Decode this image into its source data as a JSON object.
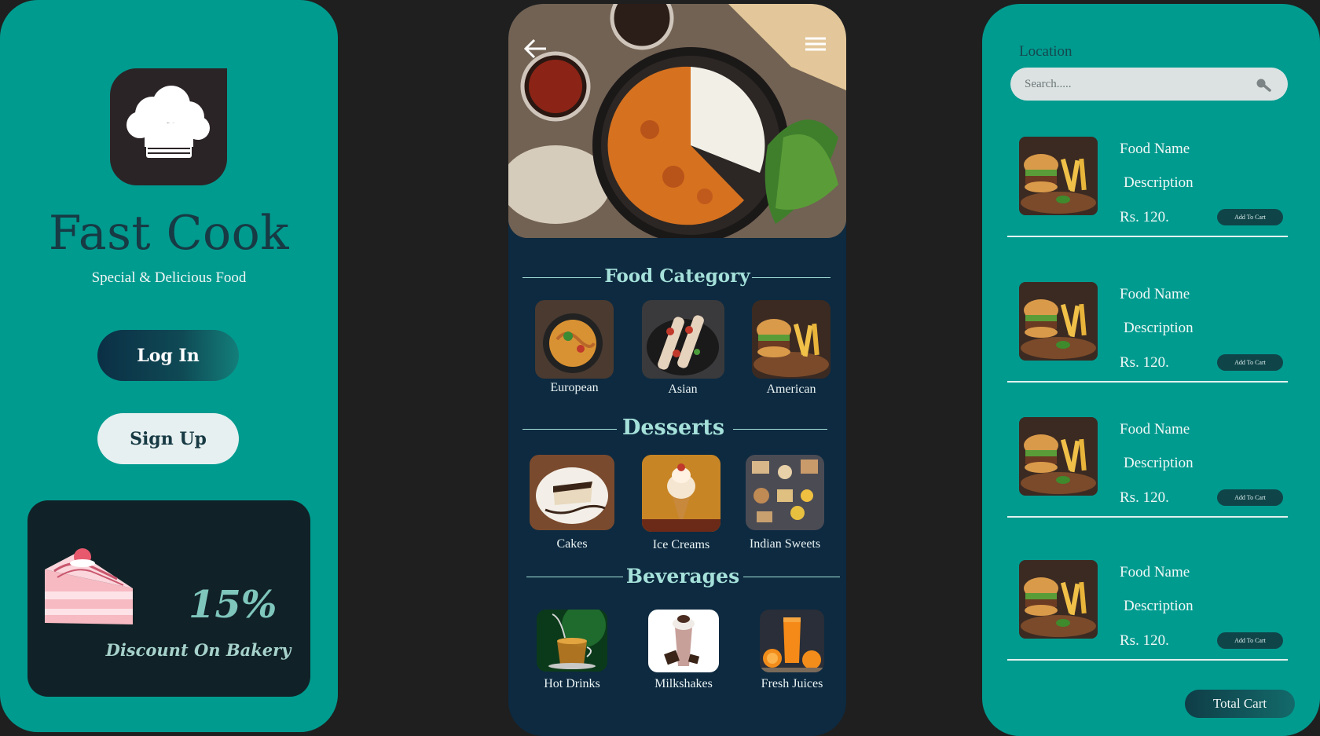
{
  "login_screen": {
    "brand_title": "Fast Cook",
    "brand_subtitle": "Special & Delicious Food",
    "login_label": "Log In",
    "signup_label": "Sign Up",
    "logo_icon": "chef-hat-icon",
    "promo": {
      "percent": "15%",
      "text": "Discount On Bakery",
      "image": "cake-slice"
    }
  },
  "category_screen": {
    "back_icon": "arrow-left-icon",
    "menu_icon": "hamburger-menu-icon",
    "hero_image": "curry-rice-bowl",
    "sections": [
      {
        "title": "Food Category",
        "items": [
          {
            "label": "European",
            "image": "pasta"
          },
          {
            "label": "Asian",
            "image": "skewers"
          },
          {
            "label": "American",
            "image": "burger-fries"
          }
        ]
      },
      {
        "title": "Desserts",
        "items": [
          {
            "label": "Cakes",
            "image": "cheesecake"
          },
          {
            "label": "Ice Creams",
            "image": "ice-cream-cone"
          },
          {
            "label": "Indian Sweets",
            "image": "indian-sweets"
          }
        ]
      },
      {
        "title": "Beverages",
        "items": [
          {
            "label": "Hot Drinks",
            "image": "tea-cup"
          },
          {
            "label": "Milkshakes",
            "image": "milkshake"
          },
          {
            "label": "Fresh Juices",
            "image": "orange-juice"
          }
        ]
      }
    ]
  },
  "cart_screen": {
    "location_label": "Location",
    "search_placeholder": "Search.....",
    "items": [
      {
        "name": "Food Name",
        "description": "Description",
        "price": "Rs. 120.",
        "button": "Add To Cart"
      },
      {
        "name": "Food Name",
        "description": "Description",
        "price": "Rs. 120.",
        "button": "Add To Cart"
      },
      {
        "name": "Food Name",
        "description": "Description",
        "price": "Rs. 120.",
        "button": "Add To Cart"
      },
      {
        "name": "Food Name",
        "description": "Description",
        "price": "Rs. 120.",
        "button": "Add To Cart"
      }
    ],
    "total_cart_label": "Total Cart"
  },
  "colors": {
    "teal_panel": "#009b8f",
    "navy_panel": "#0d2a40",
    "background": "#1f1f1f",
    "accent_text": "#a5e1da"
  }
}
